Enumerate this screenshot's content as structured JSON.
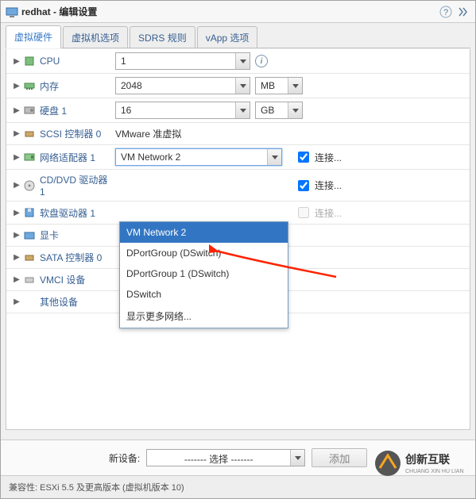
{
  "window": {
    "title": "redhat - 编辑设置"
  },
  "tabs": [
    "虚拟硬件",
    "虚拟机选项",
    "SDRS 规则",
    "vApp 选项"
  ],
  "hw": {
    "cpu": {
      "label": "CPU",
      "value": "1"
    },
    "mem": {
      "label": "内存",
      "value": "2048",
      "unit": "MB"
    },
    "disk": {
      "label": "硬盘 1",
      "value": "16",
      "unit": "GB"
    },
    "scsi": {
      "label": "SCSI 控制器 0",
      "value": "VMware 准虚拟"
    },
    "net": {
      "label": "网络适配器 1",
      "value": "VM Network 2",
      "connect": "连接..."
    },
    "cd": {
      "label": "CD/DVD 驱动器 1",
      "connect": "连接..."
    },
    "floppy": {
      "label": "软盘驱动器 1",
      "connect": "连接..."
    },
    "video": {
      "label": "显卡"
    },
    "sata": {
      "label": "SATA 控制器 0"
    },
    "vmci": {
      "label": "VMCI 设备"
    },
    "other": {
      "label": "其他设备"
    }
  },
  "dropdown": {
    "items": [
      "VM Network 2",
      "DPortGroup (DSwitch)",
      "DPortGroup 1 (DSwitch)",
      "DSwitch",
      "显示更多网络..."
    ]
  },
  "footer": {
    "newdev_label": "新设备:",
    "select_placeholder": "-------  选择  -------",
    "add_btn": "添加",
    "compat": "兼容性: ESXi 5.5 及更高版本 (虚拟机版本 10)"
  },
  "watermark": "创新互联"
}
